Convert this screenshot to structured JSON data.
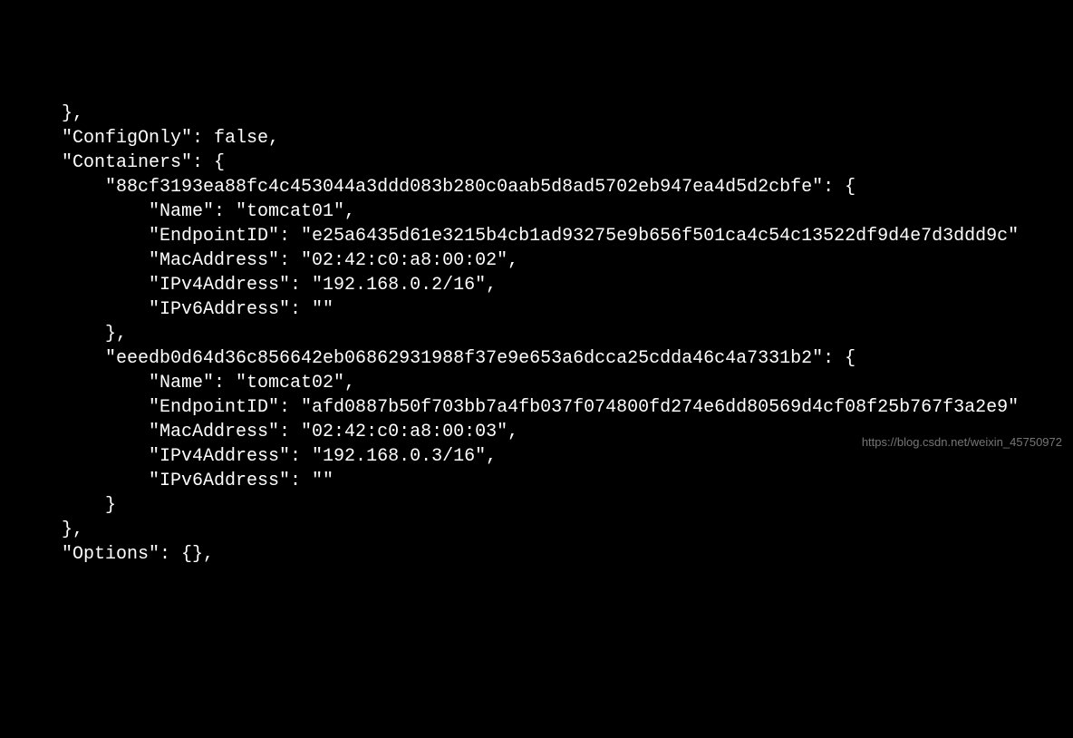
{
  "json_output": {
    "line01": "    },",
    "line02": "    \"ConfigOnly\": false,",
    "line03": "    \"Containers\": {",
    "line04": "        \"88cf3193ea88fc4c453044a3ddd083b280c0aab5d8ad5702eb947ea4d5d2cbfe\": {",
    "line05": "            \"Name\": \"tomcat01\",",
    "line06": "            \"EndpointID\": \"e25a6435d61e3215b4cb1ad93275e9b656f501ca4c54c13522df9d4e7d3ddd9c\"",
    "line07": "            \"MacAddress\": \"02:42:c0:a8:00:02\",",
    "line08": "            \"IPv4Address\": \"192.168.0.2/16\",",
    "line09": "            \"IPv6Address\": \"\"",
    "line10": "        },",
    "line11": "        \"eeedb0d64d36c856642eb06862931988f37e9e653a6dcca25cdda46c4a7331b2\": {",
    "line12": "            \"Name\": \"tomcat02\",",
    "line13": "            \"EndpointID\": \"afd0887b50f703bb7a4fb037f074800fd274e6dd80569d4cf08f25b767f3a2e9\"",
    "line14": "            \"MacAddress\": \"02:42:c0:a8:00:03\",",
    "line15": "            \"IPv4Address\": \"192.168.0.3/16\",",
    "line16": "            \"IPv6Address\": \"\"",
    "line17": "        }",
    "line18": "    },",
    "line19": "    \"Options\": {},"
  },
  "watermark": "https://blog.csdn.net/weixin_45750972"
}
